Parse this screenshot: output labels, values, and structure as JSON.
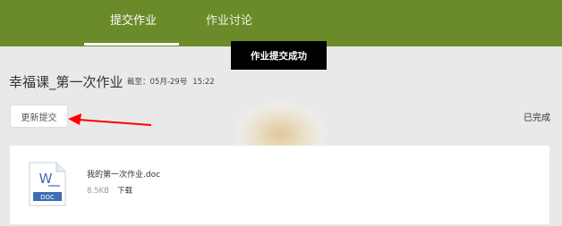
{
  "header": {
    "tabs": [
      {
        "label": "提交作业",
        "active": true
      },
      {
        "label": "作业讨论",
        "active": false
      }
    ],
    "bg_color": "#6b8a2a"
  },
  "toast": {
    "message": "作业提交成功"
  },
  "assignment": {
    "title": "幸福课_第一次作业",
    "deadline_label": "截至：05月-29号",
    "deadline_time": "15:22",
    "resubmit_label": "更新提交",
    "status": "已完成"
  },
  "file": {
    "icon_letter": "W",
    "icon_type": "DOC",
    "name": "我的第一次作业.doc",
    "size": "8.5KB",
    "download_label": "下载"
  },
  "annotation": {
    "arrow_color": "#ff0000"
  }
}
